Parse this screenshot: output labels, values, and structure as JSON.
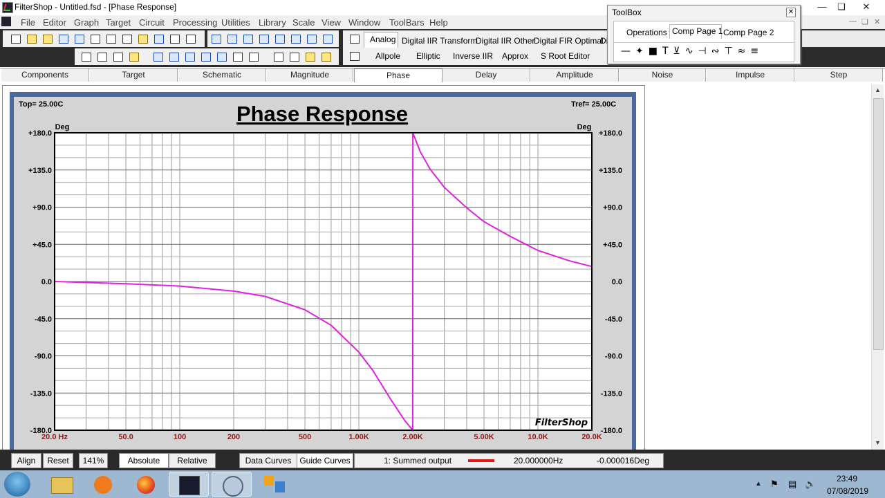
{
  "window": {
    "title": "FilterShop - Untitled.fsd - [Phase Response]"
  },
  "menu": [
    "File",
    "Editor",
    "Graph",
    "Target",
    "Circuit",
    "Processing",
    "Utilities",
    "Library",
    "Scale",
    "View",
    "Window",
    "ToolBars",
    "Help"
  ],
  "filter_tabs": {
    "row1": [
      "Analog",
      "Digital IIR Transform",
      "Digital IIR Other",
      "Digital FIR Optimal",
      "Di"
    ],
    "row2": [
      "Allpole",
      "Elliptic",
      "Inverse IIR",
      "Approx",
      "S Root Editor"
    ]
  },
  "toolbox": {
    "title": "ToolBox",
    "tabs": [
      "Operations",
      "Comp Page 1",
      "Comp Page 2"
    ]
  },
  "view_tabs": [
    "Components",
    "Target",
    "Schematic",
    "Magnitude",
    "Phase",
    "Delay",
    "Amplitude",
    "Noise",
    "Impulse",
    "Step"
  ],
  "chart_header": {
    "top_label": "Top=  25.00C",
    "tref_label": "Tref=  25.00C",
    "watermark": "FilterShop"
  },
  "chart_data": {
    "type": "line",
    "title": "Phase Response",
    "ylabel": "Deg",
    "ylabel_right": "Deg",
    "xscale": "log",
    "xlim": [
      20,
      20000
    ],
    "ylim": [
      -180,
      180
    ],
    "y_ticks": [
      180,
      135,
      90,
      45,
      0,
      -45,
      -90,
      -135,
      -180
    ],
    "y_tick_labels": [
      "+180.0",
      "+135.0",
      "+90.0",
      "+45.0",
      "0.0",
      "-45.0",
      "-90.0",
      "-135.0",
      "-180.0"
    ],
    "x_ticks": [
      20,
      50,
      100,
      200,
      500,
      1000,
      2000,
      5000,
      10000,
      20000
    ],
    "x_tick_labels": [
      "20.0 Hz",
      "50.0",
      "100",
      "200",
      "500",
      "1.00K",
      "2.00K",
      "5.00K",
      "10.0K",
      "20.0K"
    ],
    "grid": true,
    "line_color": "#e020e0",
    "series": [
      {
        "x": [
          20,
          50,
          100,
          200,
          300,
          500,
          700,
          1000,
          1200,
          1500,
          1800,
          1999,
          2001,
          2200,
          2500,
          3000,
          4000,
          5000,
          7000,
          10000,
          15000,
          20000
        ],
        "y": [
          0.0,
          -2.7,
          -5.5,
          -11.6,
          -18,
          -34.2,
          -53,
          -85.4,
          -108,
          -142,
          -168,
          -179.9,
          179.9,
          157.3,
          136,
          114,
          89.2,
          72.4,
          54.7,
          37.6,
          25,
          18.2
        ]
      }
    ]
  },
  "status": {
    "align": "Align",
    "reset": "Reset",
    "zoom": "141%",
    "absolute": "Absolute",
    "relative": "Relative",
    "data_curves": "Data Curves",
    "guide_curves": "Guide Curves",
    "series_label": "1: Summed output",
    "cursor_x": "20.000000Hz",
    "cursor_y": "-0.000016Deg",
    "accent_color": "#dd1a1a"
  },
  "clock": {
    "time": "23:49",
    "date": "07/08/2019"
  }
}
